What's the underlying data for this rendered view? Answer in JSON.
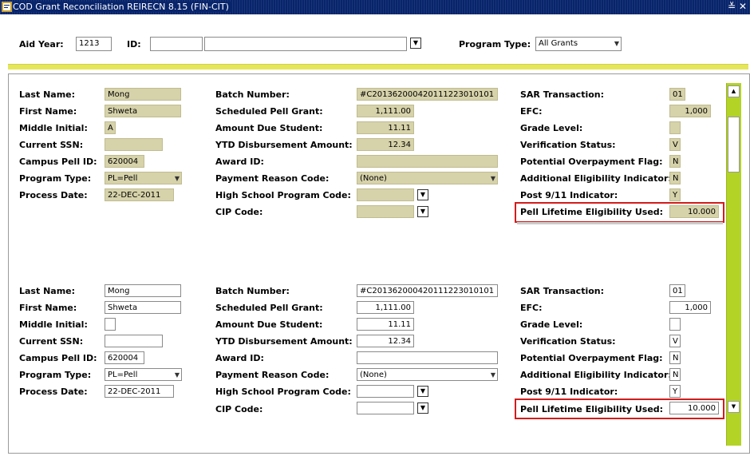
{
  "window": {
    "title": "COD Grant Reconciliation  REIRECN  8.15  (FIN-CIT)",
    "icon": "form-icon",
    "controls": [
      "≚",
      "✕"
    ]
  },
  "key_block": {
    "aid_year_label": "Aid Year:",
    "aid_year_value": "1213",
    "id_label": "ID:",
    "id_value": "",
    "name_value": "",
    "program_type_label": "Program Type:",
    "program_type_value": "All Grants"
  },
  "labels": {
    "last_name": "Last Name:",
    "first_name": "First Name:",
    "middle_initial": "Middle Initial:",
    "current_ssn": "Current SSN:",
    "campus_pell_id": "Campus Pell ID:",
    "program_type": "Program Type:",
    "process_date": "Process Date:",
    "batch_number": "Batch Number:",
    "scheduled_pell_grant": "Scheduled Pell Grant:",
    "amount_due_student": "Amount Due Student:",
    "ytd_disbursement_amount": "YTD Disbursement Amount:",
    "award_id": "Award ID:",
    "payment_reason_code": "Payment Reason Code:",
    "high_school_program_code": "High School Program Code:",
    "cip_code": "CIP Code:",
    "sar_transaction": "SAR Transaction:",
    "efc": "EFC:",
    "grade_level": "Grade Level:",
    "verification_status": "Verification Status:",
    "potential_overpayment_flag": "Potential Overpayment Flag:",
    "additional_eligibility_indicator": "Additional Eligibility Indicator:",
    "post_911_indicator": "Post 9/11 Indicator:",
    "pell_lifetime_eligibility_used": "Pell Lifetime Eligibility Used:"
  },
  "records": [
    {
      "last_name": "Mong",
      "first_name": "Shweta",
      "middle_initial": "A",
      "current_ssn": "",
      "campus_pell_id": "620004",
      "program_type": "PL=Pell",
      "process_date": "22-DEC-2011",
      "batch_number": "#C201362000420111223010101",
      "scheduled_pell_grant": "1,111.00",
      "amount_due_student": "11.11",
      "ytd_disbursement_amount": "12.34",
      "award_id": "",
      "payment_reason_code": "(None)",
      "high_school_program_code": "",
      "cip_code": "",
      "sar_transaction": "01",
      "efc": "1,000",
      "grade_level": "",
      "verification_status": "V",
      "potential_overpayment_flag": "N",
      "additional_eligibility_indicator": "N",
      "post_911_indicator": "Y",
      "pell_lifetime_eligibility_used": "10.000"
    },
    {
      "last_name": "Mong",
      "first_name": "Shweta",
      "middle_initial": "",
      "current_ssn": "",
      "campus_pell_id": "620004",
      "program_type": "PL=Pell",
      "process_date": "22-DEC-2011",
      "batch_number": "#C201362000420111223010101",
      "scheduled_pell_grant": "1,111.00",
      "amount_due_student": "11.11",
      "ytd_disbursement_amount": "12.34",
      "award_id": "",
      "payment_reason_code": "(None)",
      "high_school_program_code": "",
      "cip_code": "",
      "sar_transaction": "01",
      "efc": "1,000",
      "grade_level": "",
      "verification_status": "V",
      "potential_overpayment_flag": "N",
      "additional_eligibility_indicator": "N",
      "post_911_indicator": "Y",
      "pell_lifetime_eligibility_used": "10.000"
    }
  ],
  "colors": {
    "title_bar": "#08246b",
    "readonly_field": "#d6d2aa",
    "highlight_box": "#d21c1c",
    "scrollbar": "#b3d326",
    "separator": "#e6e65a"
  }
}
